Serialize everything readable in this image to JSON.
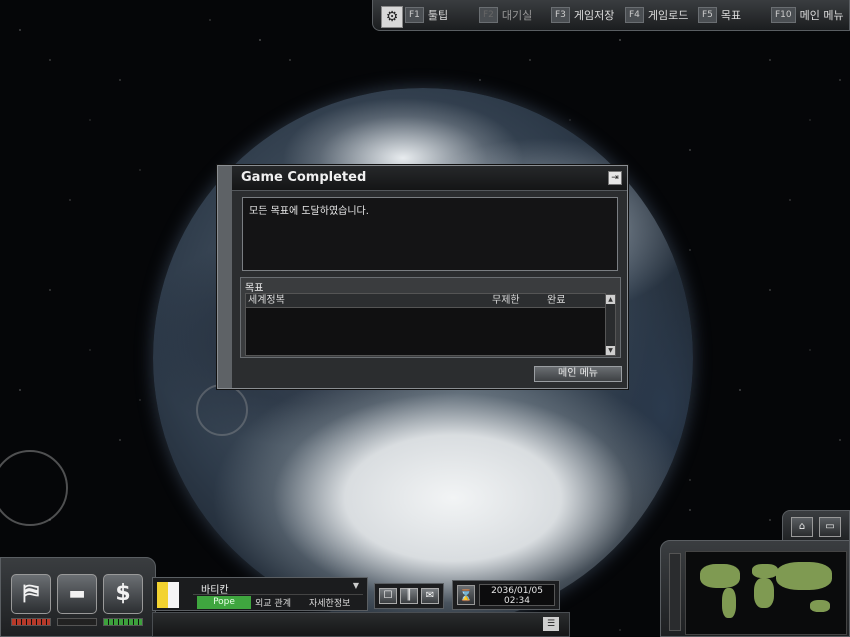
{
  "topbar": {
    "items": [
      {
        "key": "F1",
        "label": "툴팁",
        "enabled": true
      },
      {
        "key": "F2",
        "label": "대기실",
        "enabled": false
      },
      {
        "key": "F3",
        "label": "게임저장",
        "enabled": true
      },
      {
        "key": "F4",
        "label": "게임로드",
        "enabled": true
      },
      {
        "key": "F5",
        "label": "목표",
        "enabled": true
      },
      {
        "key": "F10",
        "label": "메인 메뉴",
        "enabled": true
      }
    ]
  },
  "dialog": {
    "title": "Game Completed",
    "message": "모든 목표에 도달하였습니다.",
    "objectives_label": "목표",
    "table_headers": [
      "세계정복",
      "무제한",
      "완료"
    ],
    "main_menu_button": "메인 메뉴"
  },
  "country": {
    "name": "바티칸",
    "leader": "Pope",
    "diplomacy": "외교 관계",
    "details": "자세한정보"
  },
  "datetime": {
    "date": "2036/01/05",
    "time": "02:34"
  },
  "colors": {
    "accent_green": "#3fa63f",
    "dialog_bg": "#2b2d2f",
    "panel_border": "#5a5e62"
  },
  "icons": [
    "gear-icon",
    "close-icon",
    "podium-icon",
    "tank-icon",
    "dollar-icon",
    "chat-icon",
    "chart-icon",
    "mail-icon",
    "hourglass-icon",
    "home-icon",
    "camera-icon",
    "log-icon"
  ]
}
